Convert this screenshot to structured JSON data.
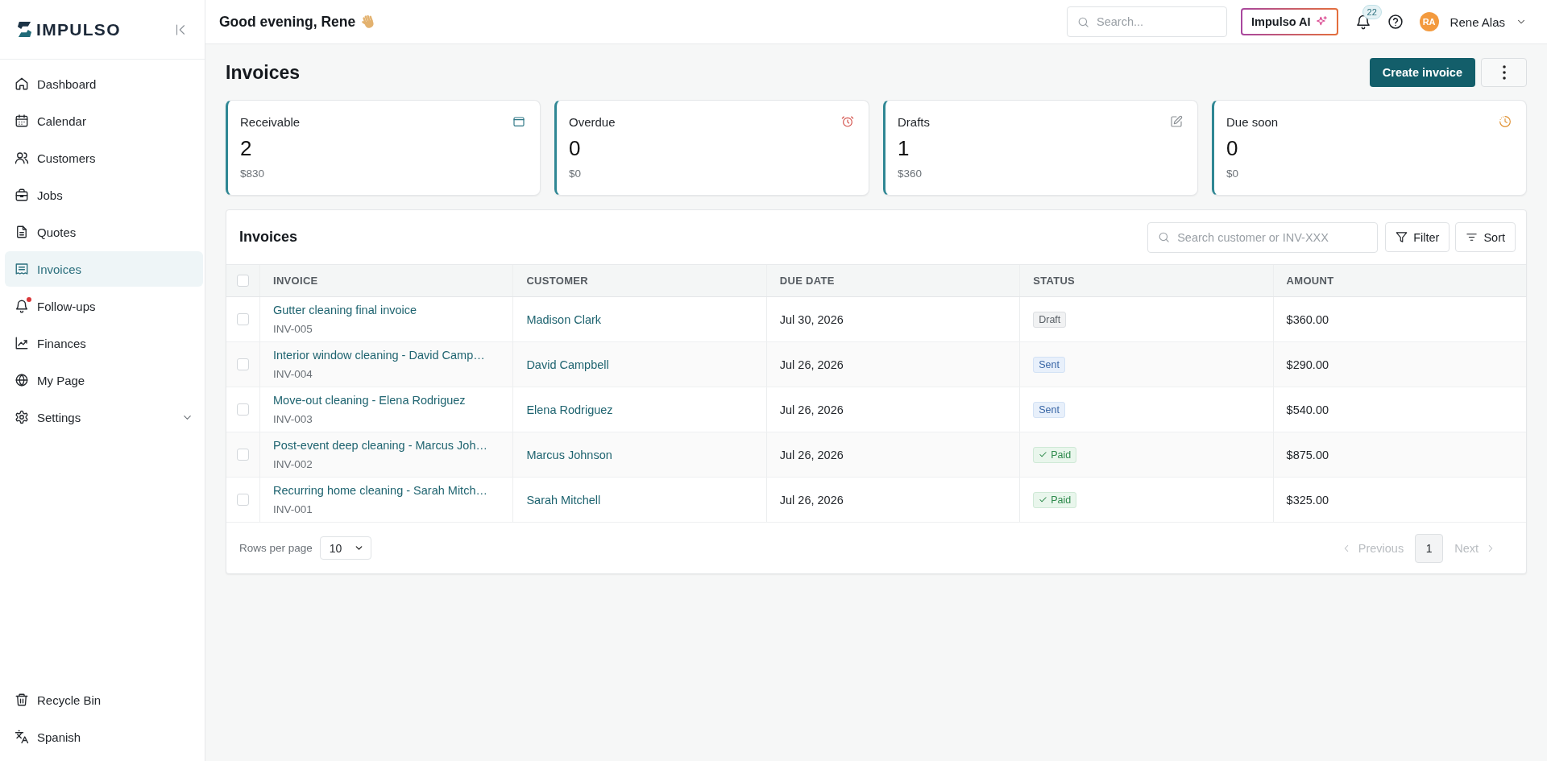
{
  "sidebar": {
    "logo": "IMPULSO",
    "items": [
      {
        "label": "Dashboard",
        "kind": "link",
        "selected": false,
        "alert": false
      },
      {
        "label": "Calendar",
        "kind": "link",
        "selected": false,
        "alert": false
      },
      {
        "label": "Customers",
        "kind": "link",
        "selected": false,
        "alert": false
      },
      {
        "label": "Jobs",
        "kind": "link",
        "selected": false,
        "alert": false
      },
      {
        "label": "Quotes",
        "kind": "link",
        "selected": false,
        "alert": false
      },
      {
        "label": "Invoices",
        "kind": "link",
        "selected": true,
        "alert": false
      },
      {
        "label": "Follow-ups",
        "kind": "link",
        "selected": false,
        "alert": true
      },
      {
        "label": "Finances",
        "kind": "link",
        "selected": false,
        "alert": false
      },
      {
        "label": "My Page",
        "kind": "link",
        "selected": false,
        "alert": false
      },
      {
        "label": "Settings",
        "kind": "group",
        "selected": false,
        "alert": false
      }
    ],
    "footer_items": [
      {
        "label": "Recycle Bin",
        "selected": false
      },
      {
        "label": "Spanish",
        "selected": false
      }
    ]
  },
  "topbar": {
    "greeting": "Good evening, Rene",
    "search": {
      "placeholder": "Search..."
    },
    "ai_button": "Impulso AI",
    "notifications": "22",
    "user": {
      "initials": "RA",
      "name": "Rene Alas"
    }
  },
  "page": {
    "title": "Invoices",
    "primary_action": "Create invoice"
  },
  "stats": [
    {
      "label": "Receivable",
      "count": "2",
      "amount": "$830"
    },
    {
      "label": "Overdue",
      "count": "0",
      "amount": "$0"
    },
    {
      "label": "Drafts",
      "count": "1",
      "amount": "$360"
    },
    {
      "label": "Due soon",
      "count": "0",
      "amount": "$0"
    }
  ],
  "table": {
    "title": "Invoices",
    "search": {
      "placeholder": "Search customer or INV-XXX"
    },
    "filter": "Filter",
    "sort": "Sort",
    "all_checked": false,
    "columns": [
      "INVOICE",
      "CUSTOMER",
      "DUE DATE",
      "STATUS",
      "AMOUNT"
    ],
    "rows": [
      {
        "checked": false,
        "title": "Gutter cleaning final invoice",
        "number": "INV-005",
        "customer": "Madison Clark",
        "due_date": "Jul 30, 2026",
        "status": {
          "label": "Draft",
          "kind": "draft"
        },
        "amount": "$360.00"
      },
      {
        "checked": false,
        "title": "Interior window cleaning - David Camp…",
        "number": "INV-004",
        "customer": "David Campbell",
        "due_date": "Jul 26, 2026",
        "status": {
          "label": "Sent",
          "kind": "sent"
        },
        "amount": "$290.00"
      },
      {
        "checked": false,
        "title": "Move-out cleaning - Elena Rodriguez",
        "number": "INV-003",
        "customer": "Elena Rodriguez",
        "due_date": "Jul 26, 2026",
        "status": {
          "label": "Sent",
          "kind": "sent"
        },
        "amount": "$540.00"
      },
      {
        "checked": false,
        "title": "Post-event deep cleaning - Marcus Joh…",
        "number": "INV-002",
        "customer": "Marcus Johnson",
        "due_date": "Jul 26, 2026",
        "status": {
          "label": "Paid",
          "kind": "paid"
        },
        "amount": "$875.00"
      },
      {
        "checked": false,
        "title": "Recurring home cleaning - Sarah Mitch…",
        "number": "INV-001",
        "customer": "Sarah Mitchell",
        "due_date": "Jul 26, 2026",
        "status": {
          "label": "Paid",
          "kind": "paid"
        },
        "amount": "$325.00"
      }
    ],
    "rows_per_page": {
      "label": "Rows per page",
      "value": "10"
    },
    "pagination": {
      "previous": {
        "label": "Previous",
        "disabled": true
      },
      "pages": [
        {
          "label": "1",
          "selected": true
        }
      ],
      "next": {
        "label": "Next",
        "disabled": true
      }
    }
  }
}
